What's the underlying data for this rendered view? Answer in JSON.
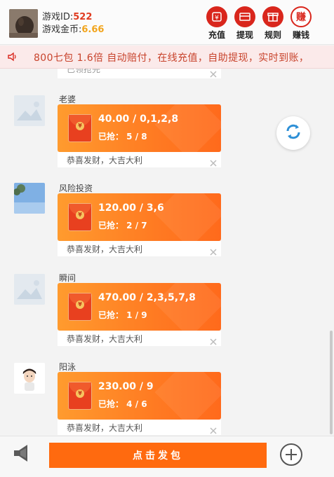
{
  "header": {
    "id_label": "游戏ID:",
    "id_value": "522",
    "coin_label": "游戏金币:",
    "coin_value": "6.66",
    "buttons": [
      {
        "label": "充值",
        "icon": "recharge-icon"
      },
      {
        "label": "提现",
        "icon": "withdraw-icon"
      },
      {
        "label": "规则",
        "icon": "rules-icon"
      },
      {
        "label": "赚钱",
        "icon": "earn-icon",
        "icon_text": "赚"
      }
    ]
  },
  "marquee": {
    "text": "800七包 1.6倍 自动赔付，在线充值，自助提现，实时到账，"
  },
  "partial_message": {
    "status": "已领抢完"
  },
  "messages": [
    {
      "user": "老婆",
      "amount": "40.00 / 0,1,2,8",
      "grabbed": "已抢： 5 / 8",
      "blessing": "恭喜发财，大吉大利",
      "avatar": "placeholder-avatar"
    },
    {
      "user": "风险投资",
      "amount": "120.00 / 3,6",
      "grabbed": "已抢： 2 / 7",
      "blessing": "恭喜发财，大吉大利",
      "avatar": "sky-photo-avatar"
    },
    {
      "user": "瞬间",
      "amount": "470.00 / 2,3,5,7,8",
      "grabbed": "已抢： 1 / 9",
      "blessing": "恭喜发财，大吉大利",
      "avatar": "placeholder-avatar"
    },
    {
      "user": "阳泳",
      "amount": "230.00 / 9",
      "grabbed": "已抢： 4 / 6",
      "blessing": "恭喜发财，大吉大利",
      "avatar": "cartoon-boy-avatar"
    }
  ],
  "envelope_icon_text": "¥",
  "bottom": {
    "send_label": "点击发包"
  },
  "colors": {
    "accent": "#d9261c",
    "packet": "#ff7a22",
    "send_button": "#ff6a0f",
    "id_value": "#e03b20",
    "coin_value": "#f2a51d",
    "marquee_text": "#c8432c"
  }
}
